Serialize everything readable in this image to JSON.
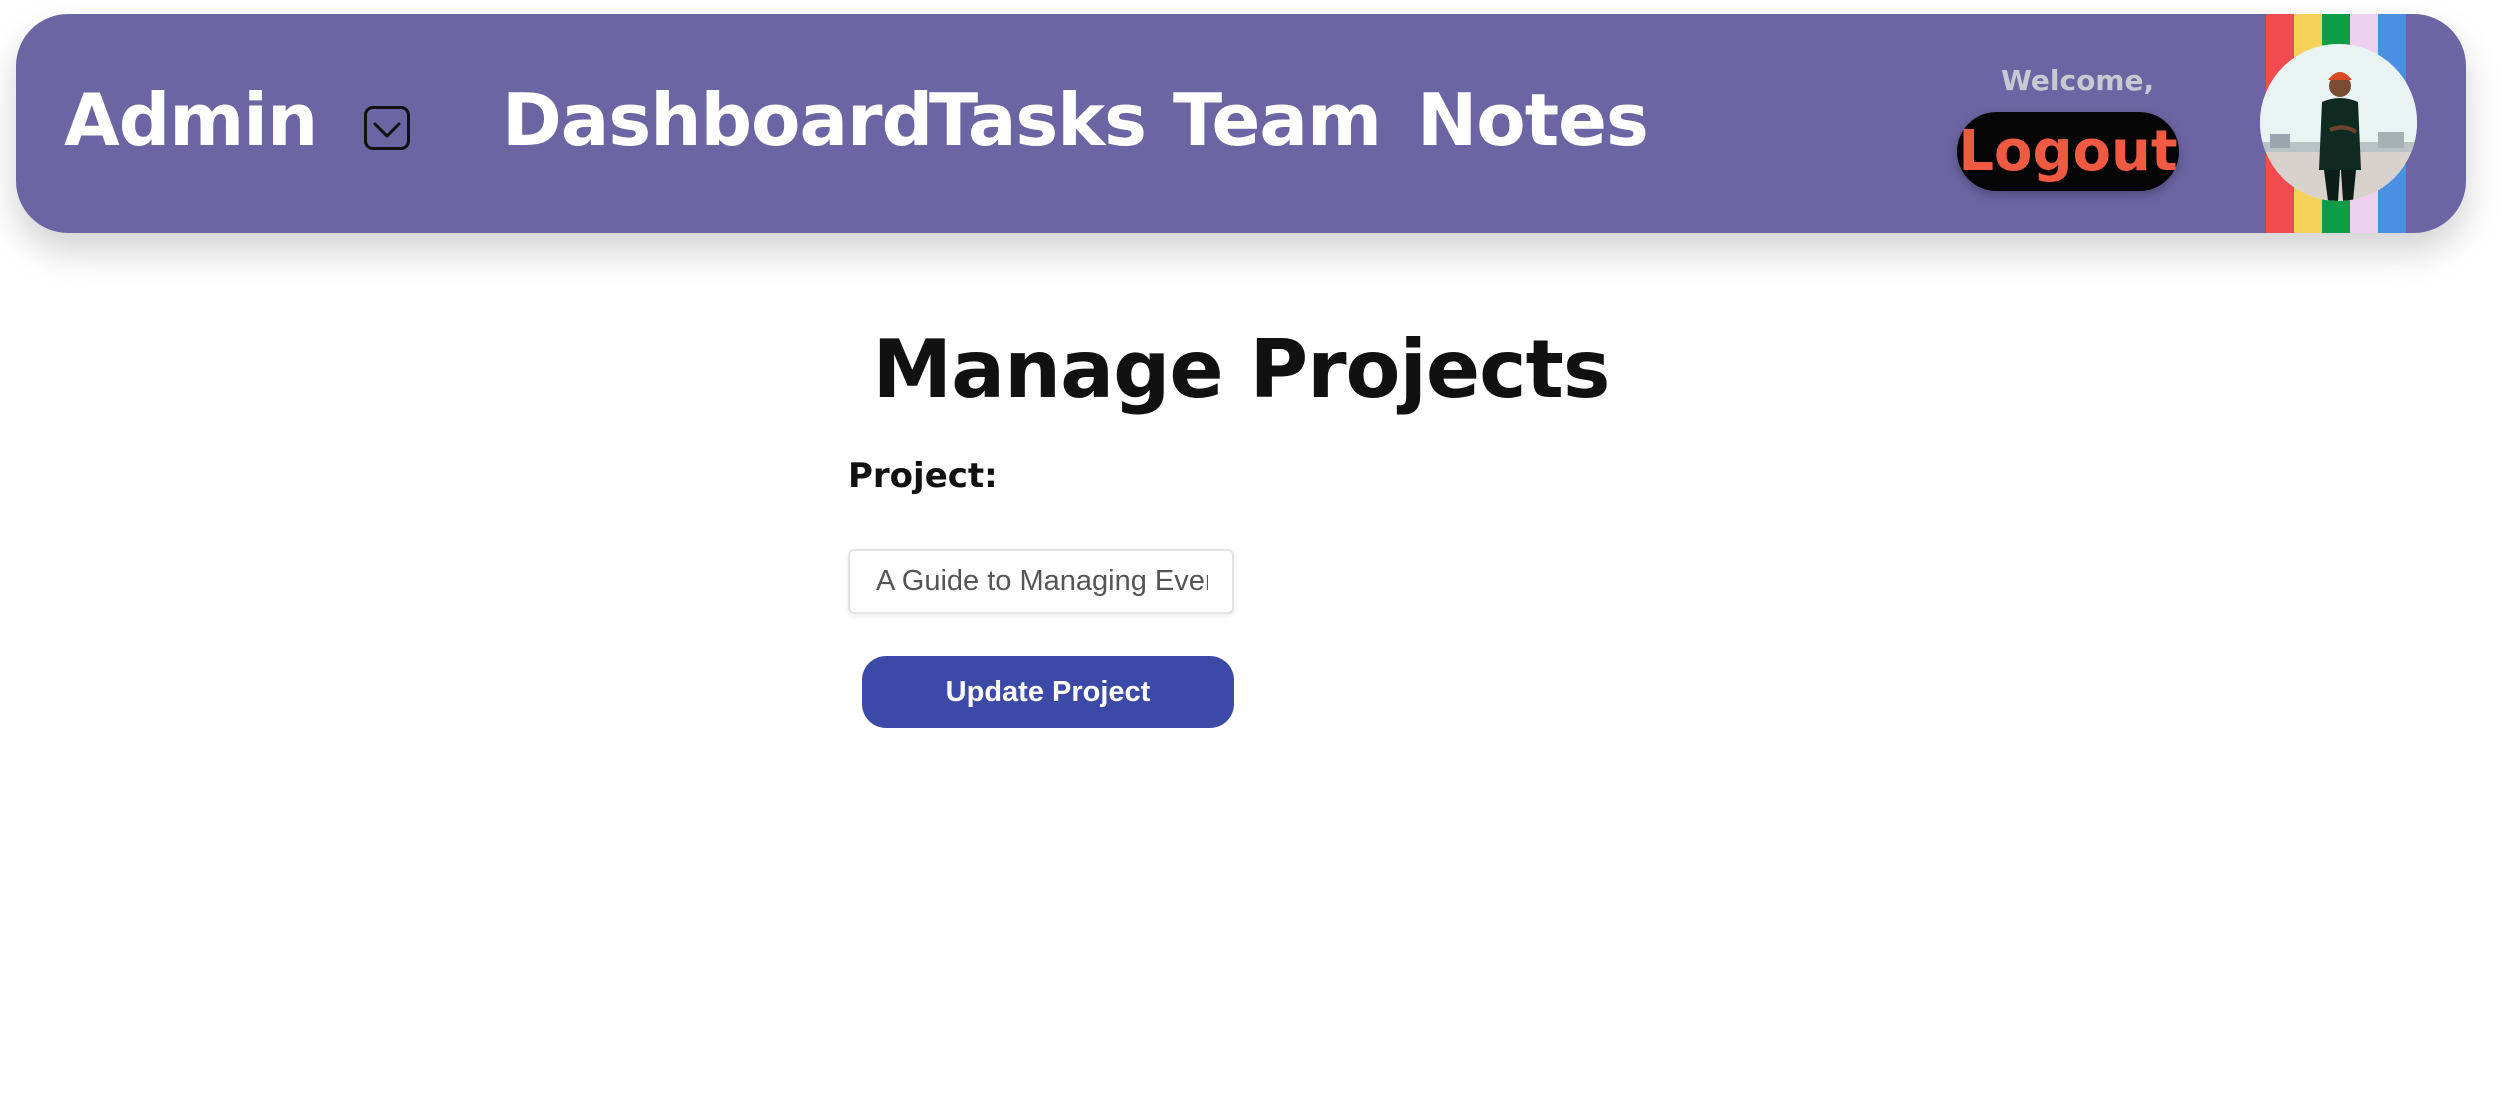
{
  "navbar": {
    "brand": "Admin",
    "dropdown_icon": "chevron-down-icon",
    "links": [
      "Dashboard",
      "Tasks",
      "Team",
      "Notes"
    ],
    "welcome": "Welcome,",
    "logout_label": "Logout",
    "stripe_colors": [
      "#f14a4f",
      "#f7d25b",
      "#0f9c47",
      "#eecff0",
      "#4a8fe2"
    ],
    "background": "#6b65a3"
  },
  "main": {
    "title": "Manage Projects",
    "project_label": "Project:",
    "project_value": "A Guide to Managing Every",
    "update_button_label": "Update Project",
    "update_button_color": "#3d49a6"
  }
}
